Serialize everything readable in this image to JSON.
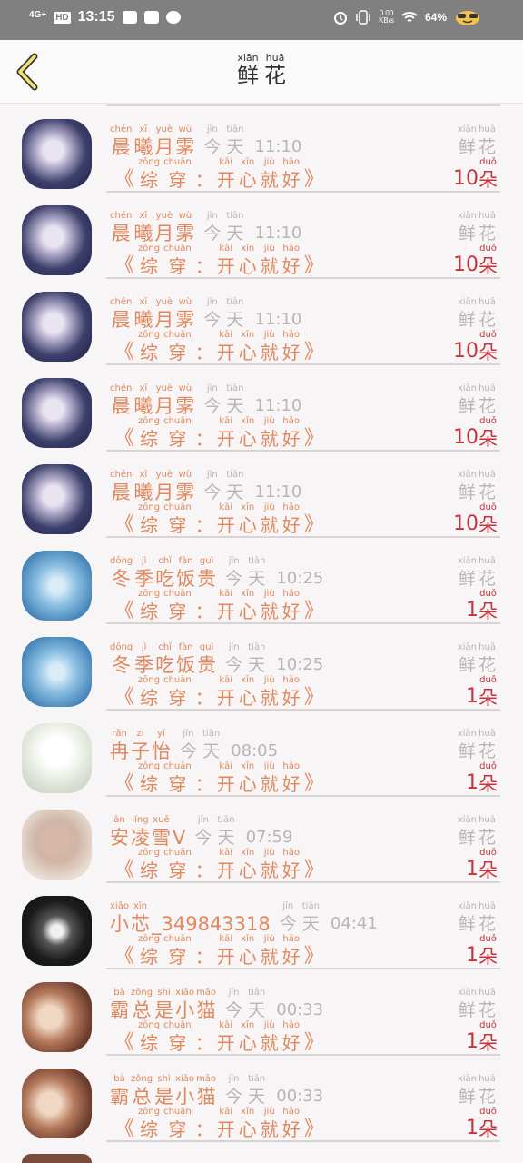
{
  "status_bar": {
    "network": "4G+",
    "hd_badge": "HD",
    "time": "13:15",
    "speed": "0.00",
    "speed_unit": "KB/s",
    "battery": "64%"
  },
  "header": {
    "title": [
      {
        "pinyin": "xiān",
        "hanzi": "鲜"
      },
      {
        "pinyin": "huā",
        "hanzi": "花"
      }
    ]
  },
  "common": {
    "today": [
      {
        "pinyin": "jīn",
        "hanzi": "今"
      },
      {
        "pinyin": "tiān",
        "hanzi": "天"
      }
    ],
    "flower": [
      {
        "pinyin": "xiān",
        "hanzi": "鲜"
      },
      {
        "pinyin": "huā",
        "hanzi": "花"
      }
    ],
    "unit": {
      "pinyin": "duǒ",
      "hanzi": "朵"
    },
    "quote_open": "《",
    "quote_close": "》",
    "book_title": [
      {
        "pinyin": "zōng",
        "hanzi": "综"
      },
      {
        "pinyin": "chuān",
        "hanzi": "穿"
      },
      {
        "pinyin": "",
        "hanzi": "："
      },
      {
        "pinyin": "kāi",
        "hanzi": "开"
      },
      {
        "pinyin": "xīn",
        "hanzi": "心"
      },
      {
        "pinyin": "jiù",
        "hanzi": "就"
      },
      {
        "pinyin": "hǎo",
        "hanzi": "好"
      }
    ]
  },
  "items": [
    {
      "name": [
        {
          "pinyin": "chén",
          "hanzi": "晨"
        },
        {
          "pinyin": "xī",
          "hanzi": "曦"
        },
        {
          "pinyin": "yuè",
          "hanzi": "月"
        },
        {
          "pinyin": "wù",
          "hanzi": "雺"
        }
      ],
      "time": "11:10",
      "count": "10",
      "avatar": "avatar-girl-night"
    },
    {
      "name": [
        {
          "pinyin": "chén",
          "hanzi": "晨"
        },
        {
          "pinyin": "xī",
          "hanzi": "曦"
        },
        {
          "pinyin": "yuè",
          "hanzi": "月"
        },
        {
          "pinyin": "wù",
          "hanzi": "雺"
        }
      ],
      "time": "11:10",
      "count": "10",
      "avatar": "avatar-girl-night"
    },
    {
      "name": [
        {
          "pinyin": "chén",
          "hanzi": "晨"
        },
        {
          "pinyin": "xī",
          "hanzi": "曦"
        },
        {
          "pinyin": "yuè",
          "hanzi": "月"
        },
        {
          "pinyin": "wù",
          "hanzi": "雺"
        }
      ],
      "time": "11:10",
      "count": "10",
      "avatar": "avatar-girl-night"
    },
    {
      "name": [
        {
          "pinyin": "chén",
          "hanzi": "晨"
        },
        {
          "pinyin": "xī",
          "hanzi": "曦"
        },
        {
          "pinyin": "yuè",
          "hanzi": "月"
        },
        {
          "pinyin": "wù",
          "hanzi": "雺"
        }
      ],
      "time": "11:10",
      "count": "10",
      "avatar": "avatar-girl-night"
    },
    {
      "name": [
        {
          "pinyin": "chén",
          "hanzi": "晨"
        },
        {
          "pinyin": "xī",
          "hanzi": "曦"
        },
        {
          "pinyin": "yuè",
          "hanzi": "月"
        },
        {
          "pinyin": "wù",
          "hanzi": "雺"
        }
      ],
      "time": "11:10",
      "count": "10",
      "avatar": "avatar-girl-night"
    },
    {
      "name": [
        {
          "pinyin": "dōng",
          "hanzi": "冬"
        },
        {
          "pinyin": "jì",
          "hanzi": "季"
        },
        {
          "pinyin": "chī",
          "hanzi": "吃"
        },
        {
          "pinyin": "fàn",
          "hanzi": "饭"
        },
        {
          "pinyin": "guì",
          "hanzi": "贵"
        }
      ],
      "time": "10:25",
      "count": "1",
      "avatar": "avatar-ice-heart"
    },
    {
      "name": [
        {
          "pinyin": "dōng",
          "hanzi": "冬"
        },
        {
          "pinyin": "jì",
          "hanzi": "季"
        },
        {
          "pinyin": "chī",
          "hanzi": "吃"
        },
        {
          "pinyin": "fàn",
          "hanzi": "饭"
        },
        {
          "pinyin": "guì",
          "hanzi": "贵"
        }
      ],
      "time": "10:25",
      "count": "1",
      "avatar": "avatar-ice-heart"
    },
    {
      "name": [
        {
          "pinyin": "rǎn",
          "hanzi": "冉"
        },
        {
          "pinyin": "zi",
          "hanzi": "子"
        },
        {
          "pinyin": "yí",
          "hanzi": "怡"
        }
      ],
      "time": "08:05",
      "count": "1",
      "avatar": "avatar-white-hair-boy"
    },
    {
      "name": [
        {
          "pinyin": "ān",
          "hanzi": "安"
        },
        {
          "pinyin": "líng",
          "hanzi": "凌"
        },
        {
          "pinyin": "xuě",
          "hanzi": "雪"
        },
        {
          "pinyin": "",
          "hanzi": "V"
        }
      ],
      "time": "07:59",
      "count": "1",
      "avatar": "avatar-girl-photo"
    },
    {
      "name": [
        {
          "pinyin": "xiǎo",
          "hanzi": "小"
        },
        {
          "pinyin": "xīn",
          "hanzi": "芯"
        },
        {
          "pinyin": "",
          "hanzi": "_349843318"
        }
      ],
      "time": "04:41",
      "count": "1",
      "avatar": "avatar-dark-boy"
    },
    {
      "name": [
        {
          "pinyin": "bà",
          "hanzi": "霸"
        },
        {
          "pinyin": "zǒng",
          "hanzi": "总"
        },
        {
          "pinyin": "shì",
          "hanzi": "是"
        },
        {
          "pinyin": "xiǎo",
          "hanzi": "小"
        },
        {
          "pinyin": "māo",
          "hanzi": "猫"
        }
      ],
      "time": "00:33",
      "count": "1",
      "avatar": "avatar-couple"
    },
    {
      "name": [
        {
          "pinyin": "bà",
          "hanzi": "霸"
        },
        {
          "pinyin": "zǒng",
          "hanzi": "总"
        },
        {
          "pinyin": "shì",
          "hanzi": "是"
        },
        {
          "pinyin": "xiǎo",
          "hanzi": "小"
        },
        {
          "pinyin": "māo",
          "hanzi": "猫"
        }
      ],
      "time": "00:33",
      "count": "1",
      "avatar": "avatar-couple"
    }
  ]
}
